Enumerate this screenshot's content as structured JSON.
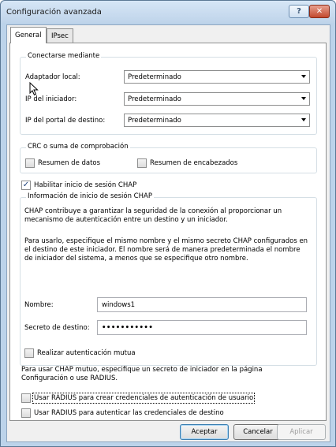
{
  "window": {
    "title": "Configuración avanzada",
    "help_glyph": "?",
    "close_glyph": "✕"
  },
  "tabs": [
    {
      "label": "General"
    },
    {
      "label": "IPsec"
    }
  ],
  "connect": {
    "title": "Conectarse mediante",
    "local_adapter": {
      "label": "Adaptador local:",
      "value": "Predeterminado"
    },
    "initiator_ip": {
      "label": "IP del iniciador:",
      "value": "Predeterminado"
    },
    "target_portal_ip": {
      "label": "IP del portal de destino:",
      "value": "Predeterminado"
    }
  },
  "crc": {
    "title": "CRC o suma de comprobación",
    "data_digest": {
      "label": "Resumen de datos",
      "checked": false
    },
    "header_digest": {
      "label": "Resumen de encabezados",
      "checked": false
    }
  },
  "chap_enable": {
    "label": "Habilitar inicio de sesión CHAP",
    "checked": true
  },
  "chap": {
    "title": "Información de inicio de sesión CHAP",
    "description": "CHAP contribuye a garantizar la seguridad de la conexión al proporcionar un mecanismo de autenticación entre un destino y un iniciador.",
    "usage": "Para usarlo, especifique el mismo nombre y el mismo secreto CHAP configurados en el destino de este iniciador. El nombre será de manera predeterminada el nombre de iniciador del sistema, a menos que se especifique otro nombre.",
    "name": {
      "label": "Nombre:",
      "value": "windows1"
    },
    "secret": {
      "label": "Secreto de destino:",
      "value": "•••••••••••"
    },
    "mutual": {
      "label": "Realizar autenticación mutua",
      "checked": false
    },
    "mutual_note": "Para usar CHAP mutuo, especifique un secreto de iniciador en la página Configuración o use RADIUS."
  },
  "radius_user": {
    "label": "Usar RADIUS para crear credenciales de autenticación de usuario",
    "checked": false
  },
  "radius_target": {
    "label": "Usar RADIUS para autenticar las credenciales de destino",
    "checked": false
  },
  "buttons": {
    "ok": "Aceptar",
    "cancel": "Cancelar",
    "apply": "Aplicar"
  },
  "colors": {
    "titlebar": "#bfd4ea",
    "close": "#c2482d",
    "default_button": "#3c7fb1"
  }
}
